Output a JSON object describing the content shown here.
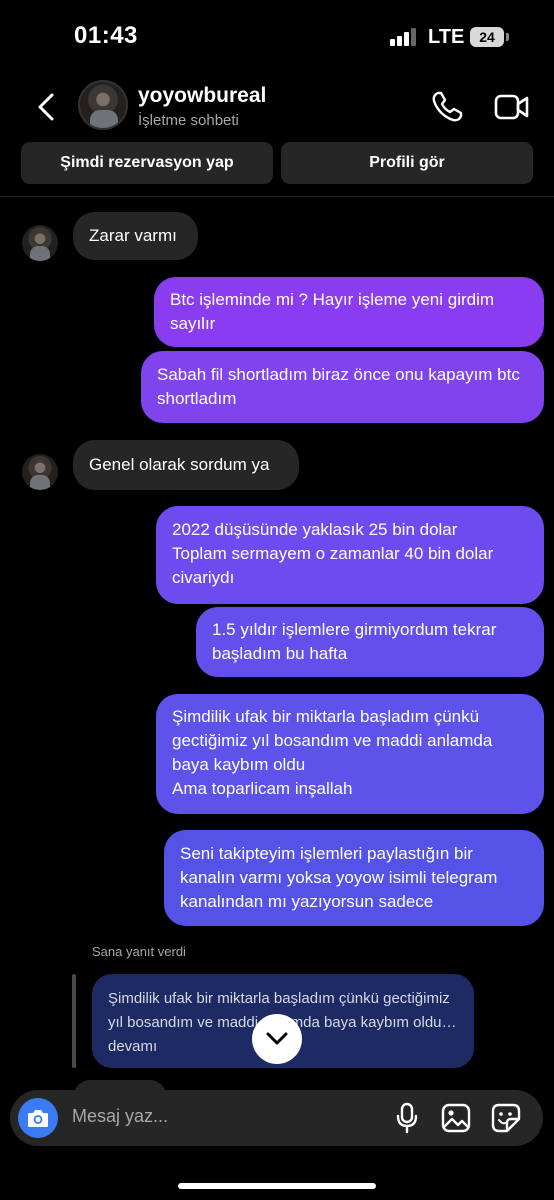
{
  "status_bar": {
    "time": "01:43",
    "network": "LTE",
    "battery": "24"
  },
  "header": {
    "name": "yoyowbureal",
    "subtitle": "İşletme sohbeti"
  },
  "actions": {
    "reserve": "Şimdi rezervasyon yap",
    "profile": "Profili gör"
  },
  "messages": [
    {
      "from": "them",
      "text": "Zarar varmı"
    },
    {
      "from": "me",
      "text": "Btc işleminde mi ? Hayır işleme yeni girdim sayılır"
    },
    {
      "from": "me",
      "text": "Sabah fil shortladım biraz önce onu kapayım btc shortladım"
    },
    {
      "from": "them",
      "text": "Genel olarak sordum ya"
    },
    {
      "from": "me",
      "text": "2022 düşüsünde yaklasık 25 bin dolar\nToplam sermayem o zamanlar 40 bin dolar civariydı"
    },
    {
      "from": "me",
      "text": "1.5 yıldır işlemlere girmiyordum tekrar başladım bu hafta"
    },
    {
      "from": "me",
      "text": "Şimdilik ufak bir miktarla başladım çünkü gectiğimiz yıl bosandım ve maddi anlamda baya kaybım oldu\nAma toparlicam inşallah"
    },
    {
      "from": "me",
      "text": "Seni takipteyim işlemleri paylastığın bir kanalın varmı yoksa yoyow isimli telegram kanalından mı yazıyorsun sadece"
    }
  ],
  "reply": {
    "note": "Sana yanıt verdi",
    "quote": "Şimdilik ufak bir miktarla başladım çünkü gectiğimiz yıl bosandım ve maddi anlamda baya kaybım oldu… devamı"
  },
  "composer": {
    "placeholder": "Mesaj yaz..."
  },
  "colors": {
    "bubble_purple": "#8a3cf0",
    "bubble_indigo": "#5552e8",
    "incoming": "#262626",
    "camera": "#3a7bf5"
  },
  "icons": [
    "back-icon",
    "phone-icon",
    "video-icon",
    "camera-icon",
    "mic-icon",
    "gallery-icon",
    "sticker-icon",
    "chevron-down-icon"
  ]
}
